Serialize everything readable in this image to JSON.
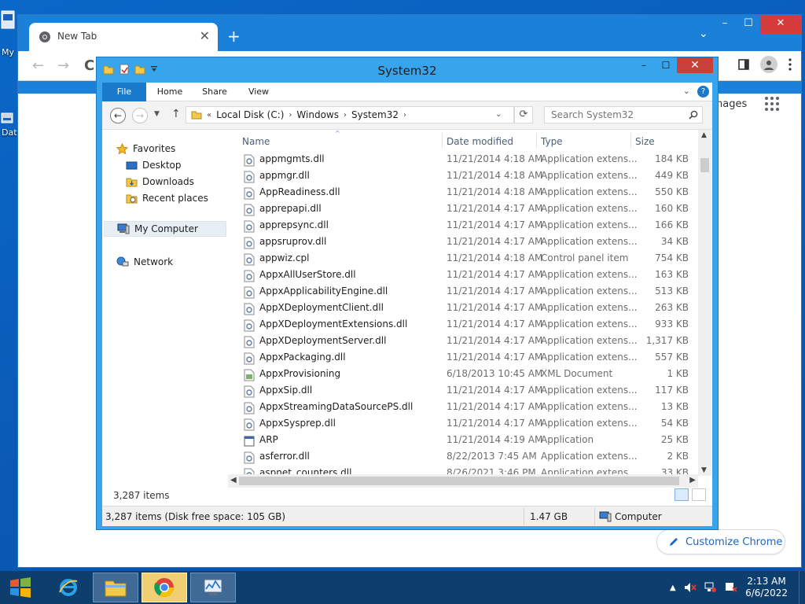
{
  "desktop": {
    "icons": [
      {
        "label": "My"
      },
      {
        "label": "Dat"
      }
    ]
  },
  "chrome": {
    "tab_title": "New Tab",
    "tab_close": "✕",
    "new_tab": "+",
    "tab_search": "⌄",
    "minimize": "–",
    "maximize": "☐",
    "close": "✕",
    "back": "←",
    "forward": "→",
    "reload": "C",
    "images_label": "nages",
    "customize_label": "Customize Chrome"
  },
  "explorer": {
    "title": "System32",
    "win_buttons": {
      "minimize": "–",
      "maximize": "☐",
      "close": "✕"
    },
    "ribbon_tabs": [
      "File",
      "Home",
      "Share",
      "View"
    ],
    "ribbon_collapse": "⌄",
    "help": "?",
    "address": {
      "overflow": "«",
      "crumbs": [
        "Local Disk (C:)",
        "Windows",
        "System32"
      ],
      "separator": "›",
      "dropdown": "⌄",
      "refresh": "⟳"
    },
    "search_placeholder": "Search System32",
    "nav_pane": {
      "favorites": "Favorites",
      "desktop": "Desktop",
      "downloads": "Downloads",
      "recent": "Recent places",
      "computer": "My Computer",
      "network": "Network"
    },
    "columns": [
      "Name",
      "Date modified",
      "Type",
      "Size"
    ],
    "sort_indicator": "^",
    "files": [
      {
        "name": "appmgmts.dll",
        "date": "11/21/2014 4:18 AM",
        "type": "Application extens...",
        "size": "184 KB",
        "icon": "dll"
      },
      {
        "name": "appmgr.dll",
        "date": "11/21/2014 4:18 AM",
        "type": "Application extens...",
        "size": "449 KB",
        "icon": "dll"
      },
      {
        "name": "AppReadiness.dll",
        "date": "11/21/2014 4:18 AM",
        "type": "Application extens...",
        "size": "550 KB",
        "icon": "dll"
      },
      {
        "name": "apprepapi.dll",
        "date": "11/21/2014 4:17 AM",
        "type": "Application extens...",
        "size": "160 KB",
        "icon": "dll"
      },
      {
        "name": "apprepsync.dll",
        "date": "11/21/2014 4:17 AM",
        "type": "Application extens...",
        "size": "166 KB",
        "icon": "dll"
      },
      {
        "name": "appsruprov.dll",
        "date": "11/21/2014 4:17 AM",
        "type": "Application extens...",
        "size": "34 KB",
        "icon": "dll"
      },
      {
        "name": "appwiz.cpl",
        "date": "11/21/2014 4:18 AM",
        "type": "Control panel item",
        "size": "754 KB",
        "icon": "dll"
      },
      {
        "name": "AppxAllUserStore.dll",
        "date": "11/21/2014 4:17 AM",
        "type": "Application extens...",
        "size": "163 KB",
        "icon": "dll"
      },
      {
        "name": "AppxApplicabilityEngine.dll",
        "date": "11/21/2014 4:17 AM",
        "type": "Application extens...",
        "size": "513 KB",
        "icon": "dll"
      },
      {
        "name": "AppXDeploymentClient.dll",
        "date": "11/21/2014 4:17 AM",
        "type": "Application extens...",
        "size": "263 KB",
        "icon": "dll"
      },
      {
        "name": "AppXDeploymentExtensions.dll",
        "date": "11/21/2014 4:17 AM",
        "type": "Application extens...",
        "size": "933 KB",
        "icon": "dll"
      },
      {
        "name": "AppXDeploymentServer.dll",
        "date": "11/21/2014 4:17 AM",
        "type": "Application extens...",
        "size": "1,317 KB",
        "icon": "dll"
      },
      {
        "name": "AppxPackaging.dll",
        "date": "11/21/2014 4:17 AM",
        "type": "Application extens...",
        "size": "557 KB",
        "icon": "dll"
      },
      {
        "name": "AppxProvisioning",
        "date": "6/18/2013 10:45 AM",
        "type": "XML Document",
        "size": "1 KB",
        "icon": "xml"
      },
      {
        "name": "AppxSip.dll",
        "date": "11/21/2014 4:17 AM",
        "type": "Application extens...",
        "size": "117 KB",
        "icon": "dll"
      },
      {
        "name": "AppxStreamingDataSourcePS.dll",
        "date": "11/21/2014 4:17 AM",
        "type": "Application extens...",
        "size": "13 KB",
        "icon": "dll"
      },
      {
        "name": "AppxSysprep.dll",
        "date": "11/21/2014 4:17 AM",
        "type": "Application extens...",
        "size": "54 KB",
        "icon": "dll"
      },
      {
        "name": "ARP",
        "date": "11/21/2014 4:19 AM",
        "type": "Application",
        "size": "25 KB",
        "icon": "exe"
      },
      {
        "name": "asferror.dll",
        "date": "8/22/2013 7:45 AM",
        "type": "Application extens...",
        "size": "2 KB",
        "icon": "dll"
      },
      {
        "name": "aspnet_counters.dll",
        "date": "8/26/2021 3:46 PM",
        "type": "Application extens...",
        "size": "33 KB",
        "icon": "dll"
      }
    ],
    "items_count": "3,287 items",
    "status": {
      "summary": "3,287 items (Disk free space: 105 GB)",
      "size": "1.47 GB",
      "location": "Computer"
    }
  },
  "taskbar": {
    "clock_time": "2:13 AM",
    "clock_date": "6/6/2022",
    "tray_chevron": "▲"
  },
  "colors": {
    "desktop": "#0a5cb8",
    "chrome_frame": "#1a80d8",
    "explorer_frame": "#37a4ec",
    "ribbon_file": "#1979ca",
    "taskbar": "#0d3e6e",
    "close_red": "#c7403a"
  }
}
